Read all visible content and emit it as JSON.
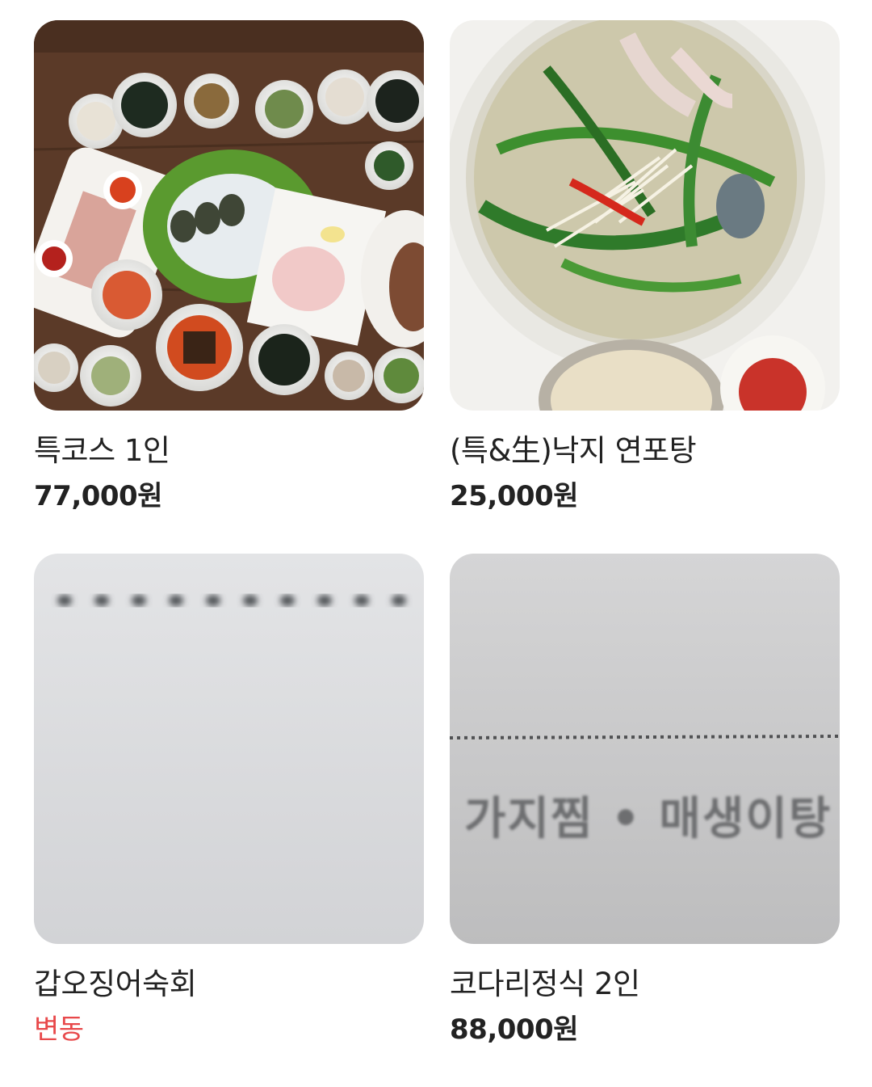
{
  "menu": {
    "items": [
      {
        "name": "특코스 1인",
        "price": "77,000원",
        "image_icon": "korean-course-table-photo",
        "price_color": "#222222"
      },
      {
        "name": "(특&生)낙지 연포탕",
        "price": "25,000원",
        "image_icon": "octopus-soup-photo",
        "price_color": "#222222"
      },
      {
        "name": "갑오징어숙회",
        "price": "변동",
        "image_icon": "blurred-menu-photo",
        "price_color": "#e8484a"
      },
      {
        "name": "코다리정식 2인",
        "price": "88,000원",
        "image_icon": "menu-board-photo",
        "image_text": "가지찜 • 매생이탕",
        "price_color": "#222222"
      }
    ]
  },
  "colors": {
    "text": "#222222",
    "accent_red": "#e8484a",
    "background": "#ffffff"
  }
}
